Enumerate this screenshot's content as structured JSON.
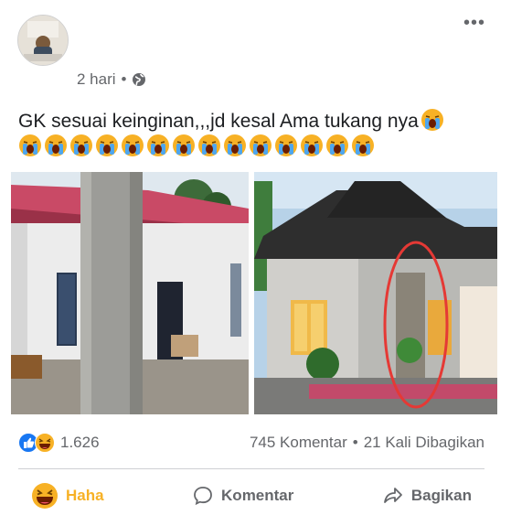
{
  "post": {
    "timestamp": "2 hari",
    "separator": "•",
    "privacy_icon": "globe-icon",
    "more_icon": "more-options-icon",
    "more_label": "•••",
    "text": "GK sesuai keinginan,,,jd kesal Ama tukang nya",
    "inline_emoji": "loudly-crying-face",
    "emoji_row_count": 14,
    "images": [
      {
        "name": "unfinished-house-photo",
        "description_icon": "house-photo"
      },
      {
        "name": "dream-house-render-photo",
        "description_icon": "house-photo"
      }
    ]
  },
  "stats": {
    "reaction_icons": [
      "like-icon",
      "haha-icon"
    ],
    "reaction_count": "1.626",
    "comments": "745 Komentar",
    "separator": "•",
    "shares": "21 Kali Dibagikan"
  },
  "actions": {
    "haha_label": "Haha",
    "comment_label": "Komentar",
    "share_label": "Bagikan"
  },
  "colors": {
    "haha_accent": "#f7b125",
    "like_blue": "#1877f2",
    "muted_text": "#65676b",
    "annotation_red": "#e53935"
  }
}
